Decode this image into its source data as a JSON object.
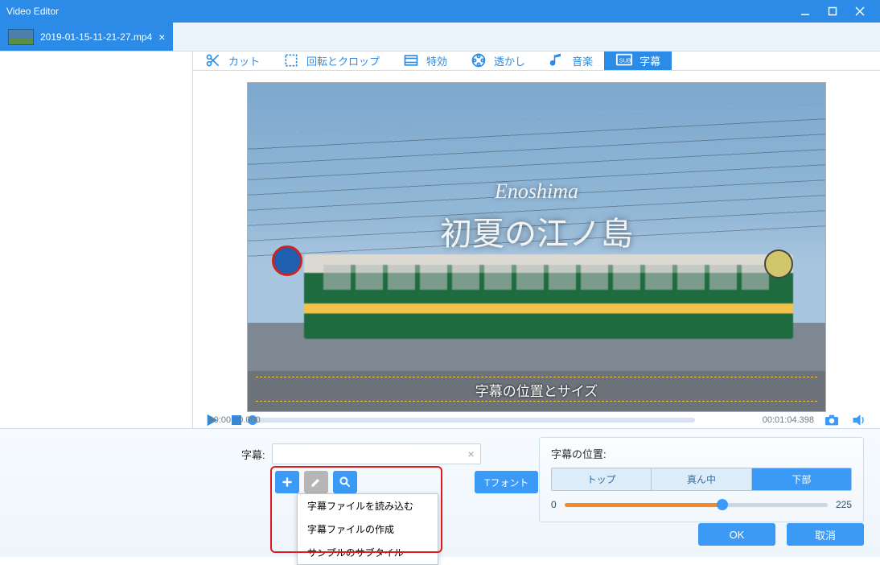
{
  "window": {
    "title": "Video Editor"
  },
  "file": {
    "name": "2019-01-15-11-21-27.mp4"
  },
  "tabs": {
    "cut": {
      "label": "カット"
    },
    "crop": {
      "label": "回転とクロップ"
    },
    "fx": {
      "label": "特効"
    },
    "water": {
      "label": "透かし"
    },
    "music": {
      "label": "音楽"
    },
    "sub": {
      "label": "字幕"
    }
  },
  "preview": {
    "title_en": "Enoshima",
    "title_jp": "初夏の江ノ島",
    "guide_caption": "字幕の位置とサイズ"
  },
  "playback": {
    "current": "00:00:00.000",
    "total": "00:01:04.398"
  },
  "subtitle_panel": {
    "label": "字幕:",
    "font_button": "Tフォント",
    "menu": {
      "load": "字幕ファイルを読み込む",
      "create": "字幕ファイルの作成",
      "sample": "サンプルのサブタイル"
    }
  },
  "position_panel": {
    "label": "字幕の位置:",
    "top": "トップ",
    "middle": "真ん中",
    "bottom": "下部",
    "min": "0",
    "value": "225"
  },
  "buttons": {
    "ok": "OK",
    "cancel": "取消"
  }
}
